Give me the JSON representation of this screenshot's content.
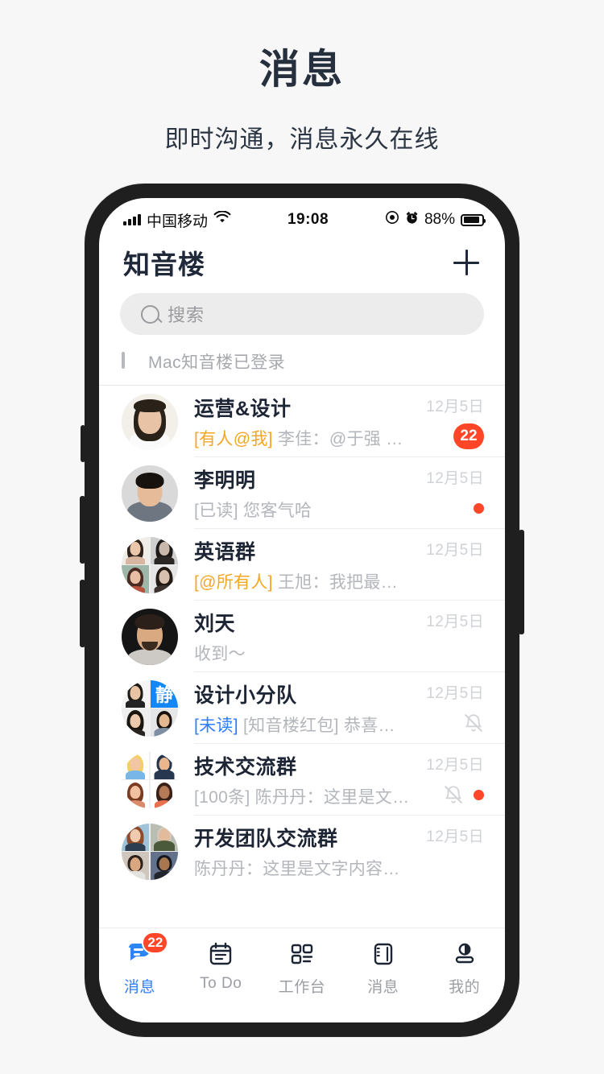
{
  "promo": {
    "title": "消息",
    "subtitle": "即时沟通，消息永久在线"
  },
  "colors": {
    "page_bg": "#f7f7f7",
    "accent_blue": "#2e7dff",
    "badge_red": "#ff4628",
    "mention_orange": "#f5a623",
    "text_dark": "#1d2535",
    "text_muted": "#b3b6bb"
  },
  "statusbar": {
    "carrier": "中国移动",
    "signal_icon": "signal-bars-icon",
    "wifi_icon": "wifi-icon",
    "time": "19:08",
    "location_icon": "location-icon",
    "alarm_icon": "alarm-icon",
    "battery_text": "88%",
    "battery_icon": "battery-icon"
  },
  "header": {
    "title": "知音楼",
    "add_icon": "plus-icon"
  },
  "search": {
    "placeholder": "搜索",
    "icon": "search-icon"
  },
  "mac_notice": {
    "icon": "monitor-icon",
    "label": "Mac知音楼已登录"
  },
  "chats": [
    {
      "name": "运营&设计",
      "prefix": "[有人@我]",
      "prefix_style": "mention",
      "message": "李佳：@于强 收到～",
      "time": "12月5日",
      "badge": "22",
      "dot": false,
      "muted": false,
      "avatar": "single-woman-1"
    },
    {
      "name": "李明明",
      "prefix": "[已读]",
      "prefix_style": "muted",
      "message": "您客气哈",
      "time": "12月5日",
      "badge": "",
      "dot": true,
      "muted": false,
      "avatar": "single-man-1"
    },
    {
      "name": "英语群",
      "prefix": "[@所有人]",
      "prefix_style": "mention",
      "message": "王旭：我把最新的文件",
      "time": "12月5日",
      "badge": "",
      "dot": false,
      "muted": false,
      "avatar": "group-women-4"
    },
    {
      "name": "刘天",
      "prefix": "",
      "prefix_style": "muted",
      "message": "收到～",
      "time": "12月5日",
      "badge": "",
      "dot": false,
      "muted": false,
      "avatar": "single-man-dark"
    },
    {
      "name": "设计小分队",
      "prefix": "[未读]",
      "prefix_style": "unread",
      "message": "[知音楼红包] 恭喜发财，大…",
      "time": "12月5日",
      "badge": "",
      "dot": false,
      "muted": true,
      "avatar": "group-jing-4"
    },
    {
      "name": "技术交流群",
      "prefix": "[100条]",
      "prefix_style": "muted",
      "message": "陈丹丹：这里是文字内容…",
      "time": "12月5日",
      "badge": "",
      "dot": true,
      "muted": true,
      "avatar": "group-illustration-4"
    },
    {
      "name": "开发团队交流群",
      "prefix": "",
      "prefix_style": "muted",
      "message": "陈丹丹：这里是文字内容文字内容…",
      "time": "12月5日",
      "badge": "",
      "dot": false,
      "muted": false,
      "avatar": "group-photo-4"
    }
  ],
  "tabbar": [
    {
      "label": "消息",
      "icon": "chat-bubble-icon",
      "active": true,
      "badge": "22"
    },
    {
      "label": "To Do",
      "icon": "calendar-icon",
      "active": false,
      "badge": ""
    },
    {
      "label": "工作台",
      "icon": "grid-apps-icon",
      "active": false,
      "badge": ""
    },
    {
      "label": "消息",
      "icon": "contact-book-icon",
      "active": false,
      "badge": ""
    },
    {
      "label": "我的",
      "icon": "person-icon",
      "active": false,
      "badge": ""
    }
  ]
}
